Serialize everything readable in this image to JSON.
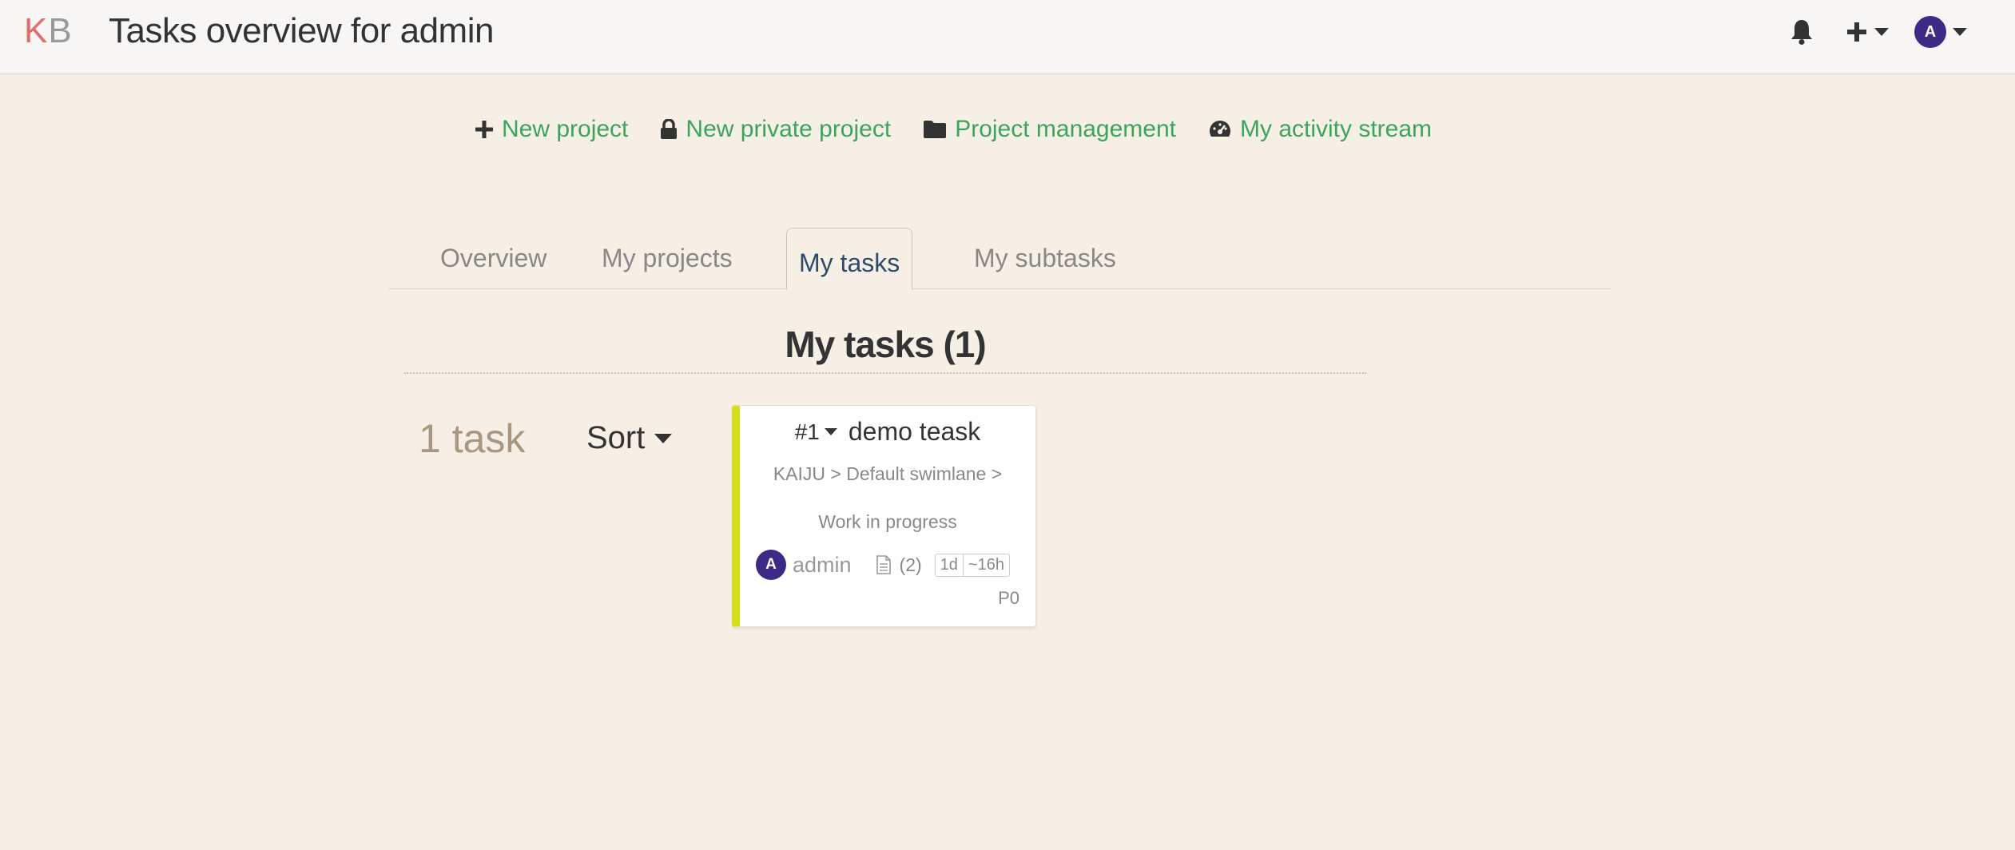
{
  "header": {
    "logo_k": "K",
    "logo_b": "B",
    "title": "Tasks overview for admin",
    "user_initial": "A"
  },
  "actions": [
    {
      "label": "New project",
      "icon": "plus-icon"
    },
    {
      "label": "New private project",
      "icon": "lock-icon"
    },
    {
      "label": "Project management",
      "icon": "folder-icon"
    },
    {
      "label": "My activity stream",
      "icon": "dashboard-icon"
    }
  ],
  "tabs": [
    {
      "label": "Overview",
      "active": false
    },
    {
      "label": "My projects",
      "active": false
    },
    {
      "label": "My tasks",
      "active": true
    },
    {
      "label": "My subtasks",
      "active": false
    }
  ],
  "section": {
    "title": "My tasks (1)",
    "task_count": "1 task",
    "sort_label": "Sort"
  },
  "task": {
    "id": "#1",
    "title": "demo teask",
    "path": "KAIJU > Default swimlane >",
    "column": "Work in progress",
    "assignee_initial": "A",
    "assignee": "admin",
    "description_count": "(2)",
    "time_estimated": "1d",
    "time_spent": "~16h",
    "priority": "P0",
    "color": "#d6de21"
  },
  "colors": {
    "accent_link": "#3ba55c",
    "avatar": "#3c2a86",
    "background": "#f6efe5"
  }
}
